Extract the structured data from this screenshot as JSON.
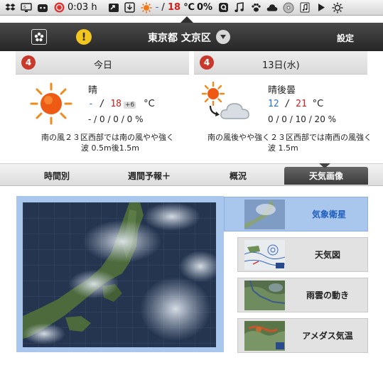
{
  "menubar": {
    "timer": "0:03 h",
    "weather_min": "-",
    "weather_sep": "/",
    "weather_max": "18",
    "weather_unit": "℃",
    "battery_or_percent": "0%",
    "icons": [
      "dropbox-icon",
      "display-icon",
      "cat-icon",
      "record-icon",
      "screenshare-icon",
      "download-icon",
      "sun-weather-icon",
      "q-icon",
      "music-note-icon",
      "paw-icon",
      "cloud-icon",
      "dvd-icon",
      "music-icon",
      "play-icon",
      "brightness-icon"
    ]
  },
  "header": {
    "location": "東京都 文京区",
    "settings_label": "設定"
  },
  "today": {
    "badge": "4",
    "title": "今日",
    "condition": "晴",
    "temp_min": "-",
    "temp_sep": "/",
    "temp_max": "18",
    "temp_diff": "+6",
    "temp_unit": "°C",
    "precip": "- / 0 / 0 / 0 %",
    "wind_line1": "南の風２３区西部では南の風やや強く",
    "wind_line2": "波 0.5m後1.5m"
  },
  "tomorrow": {
    "badge": "4",
    "title": "13日(水)",
    "condition": "晴後曇",
    "temp_min": "12",
    "temp_sep": "/",
    "temp_max": "21",
    "temp_unit": "°C",
    "precip": "0 / 0 / 10 / 20 %",
    "wind_line1": "南の風後やや強く２３区西部では南西の風強く",
    "wind_line2": "波 1.5m"
  },
  "tabs": [
    {
      "label": "時間別"
    },
    {
      "label": "週間予報＋"
    },
    {
      "label": "概況"
    },
    {
      "label": "天気画像"
    }
  ],
  "active_tab": "天気画像",
  "image_menu": [
    {
      "label": "気象衛星",
      "active": true
    },
    {
      "label": "天気図",
      "active": false
    },
    {
      "label": "雨雲の動き",
      "active": false
    },
    {
      "label": "アメダス気温",
      "active": false
    }
  ],
  "colors": {
    "accent_blue": "#a9c6ec",
    "temp_min": "#2a72c8",
    "temp_max": "#d02020",
    "badge_red": "#c8392b"
  }
}
